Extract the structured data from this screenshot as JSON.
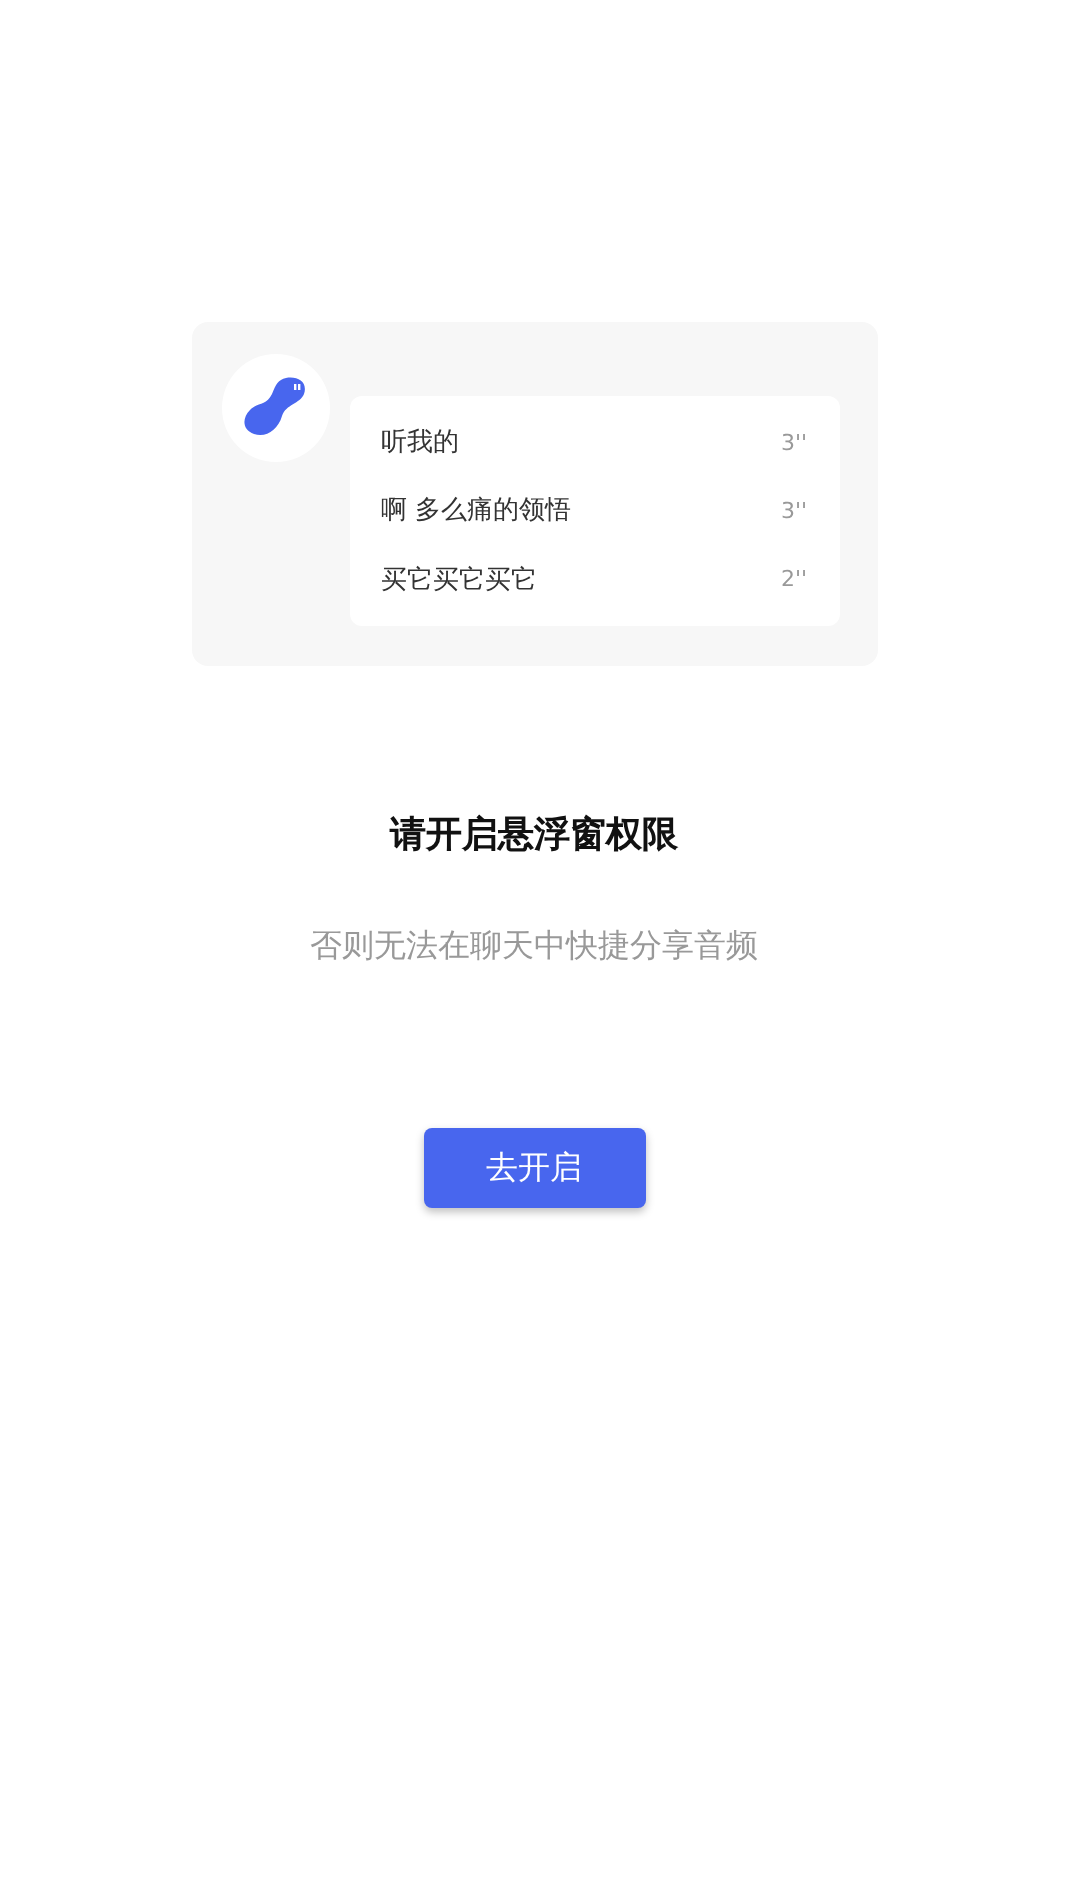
{
  "preview": {
    "items": [
      {
        "title": "听我的",
        "duration": "3''"
      },
      {
        "title": "啊 多么痛的领悟",
        "duration": "3''"
      },
      {
        "title": "买它买它买它",
        "duration": "2''"
      }
    ]
  },
  "title": "请开启悬浮窗权限",
  "subtitle": "否则无法在聊天中快捷分享音频",
  "button": "去开启"
}
